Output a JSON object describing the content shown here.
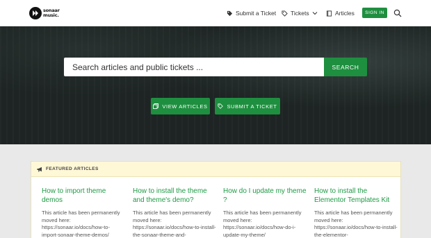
{
  "brand": {
    "line1": "sonaar",
    "line2": "music."
  },
  "nav": {
    "submit_ticket": "Submit a Ticket",
    "tickets": "Tickets",
    "articles": "Articles",
    "sign_in": "SIGN IN"
  },
  "hero": {
    "search_placeholder": "Search articles and public tickets ...",
    "search_button": "SEARCH",
    "view_articles": "VIEW ARTICLES",
    "submit_ticket": "SUBMIT A TICKET"
  },
  "featured": {
    "title": "FEATURED ARTICLES",
    "articles": [
      {
        "title": "How to import theme demos",
        "excerpt": "This article has been permanently moved here: https://sonaar.io/docs/how-to-import-sonaar-theme-demos/"
      },
      {
        "title": "How to install the theme and theme's demo?",
        "excerpt": "This article has been permanently moved here: https://sonaar.io/docs/how-to-install-the-sonaar-theme-and-"
      },
      {
        "title": "How do I update my theme ?",
        "excerpt": "This article has been permanently moved here: https://sonaar.io/docs/how-do-i-update-my-theme/"
      },
      {
        "title": "How to install the Elementor Templates Kit",
        "excerpt": "This article has been permanently moved here: https://sonaar.io/docs/how-to-install-the-elementor-"
      }
    ]
  },
  "colors": {
    "accent": "#1e8f3f",
    "link": "#1e9b45",
    "hero_bg": "#1d2423",
    "featured_head": "#fff8d6"
  }
}
